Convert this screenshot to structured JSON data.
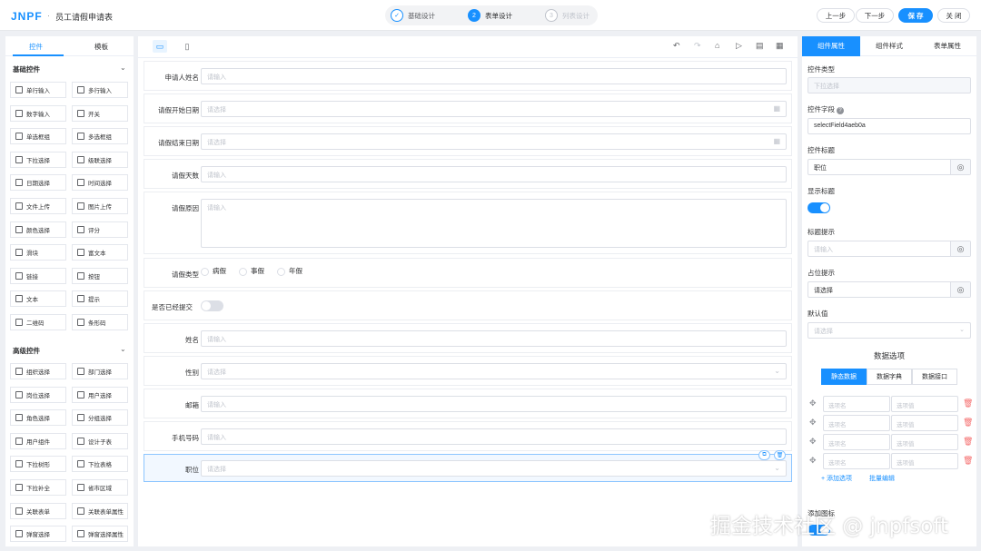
{
  "header": {
    "logo_main": "JNPF",
    "logo_sep": "·",
    "app_title": "员工请假申请表",
    "steps": [
      {
        "num": "✓",
        "label": "基础设计"
      },
      {
        "num": "2",
        "label": "表单设计"
      },
      {
        "num": "3",
        "label": "列表设计"
      }
    ],
    "prev_label": "上一步",
    "next_label": "下一步",
    "save_label": "保 存",
    "close_label": "关 闭"
  },
  "left": {
    "tabs": [
      "控件",
      "模板"
    ],
    "basic_group": "基础控件",
    "basic_items": [
      "单行输入",
      "多行输入",
      "数字输入",
      "开关",
      "单选框组",
      "多选框组",
      "下拉选择",
      "级联选择",
      "日期选择",
      "时间选择",
      "文件上传",
      "图片上传",
      "颜色选择",
      "评分",
      "滑块",
      "富文本",
      "链接",
      "按钮",
      "文本",
      "提示",
      "二维码",
      "条形码"
    ],
    "advanced_group": "高级控件",
    "advanced_items": [
      "组织选择",
      "部门选择",
      "岗位选择",
      "用户选择",
      "角色选择",
      "分组选择",
      "用户组件",
      "设计子表",
      "下拉树形",
      "下拉表格",
      "下拉补全",
      "省市区域",
      "关联表单",
      "关联表单属性",
      "弹窗选择",
      "弹窗选择属性"
    ]
  },
  "form": {
    "fields": [
      {
        "label": "申请人姓名",
        "placeholder": "请输入"
      },
      {
        "label": "请假开始日期",
        "placeholder": "请选择"
      },
      {
        "label": "请假结束日期",
        "placeholder": "请选择"
      },
      {
        "label": "请假天数",
        "placeholder": "请输入"
      },
      {
        "label": "请假原因",
        "placeholder": "请输入"
      },
      {
        "label": "请假类型",
        "options": [
          "病假",
          "事假",
          "年假"
        ]
      },
      {
        "label": "是否已经提交",
        "switch_on": false
      },
      {
        "label": "姓名",
        "placeholder": "请输入"
      },
      {
        "label": "性别",
        "placeholder": "请选择"
      },
      {
        "label": "邮箱",
        "placeholder": "请输入"
      },
      {
        "label": "手机号码",
        "placeholder": "请输入"
      },
      {
        "label": "职位",
        "placeholder": "请选择"
      }
    ]
  },
  "props": {
    "tabs": [
      "组件属性",
      "组件样式",
      "表单属性"
    ],
    "type_label": "控件类型",
    "type_value": "下拉选择",
    "field_label": "控件字段",
    "field_value": "selectField4aeb0a",
    "title_label": "控件标题",
    "title_value": "职位",
    "show_title_label": "显示标题",
    "show_title_on": true,
    "tip_label": "标题提示",
    "tip_placeholder": "请输入",
    "placeholder_label": "占位提示",
    "placeholder_value": "请选择",
    "default_label": "默认值",
    "default_placeholder": "请选择",
    "data_title": "数据选项",
    "data_tabs": [
      "静态数据",
      "数据字典",
      "数据接口"
    ],
    "option_name_ph": "选项名",
    "option_value_ph": "选项值",
    "add_option": "+ 添加选项",
    "batch_edit": "批量编辑",
    "partial_label": "添加图标"
  },
  "watermark": "掘金技术社区 @ jnpfsoft",
  "colors": {
    "primary": "#1890ff",
    "danger": "#f56c6c"
  }
}
